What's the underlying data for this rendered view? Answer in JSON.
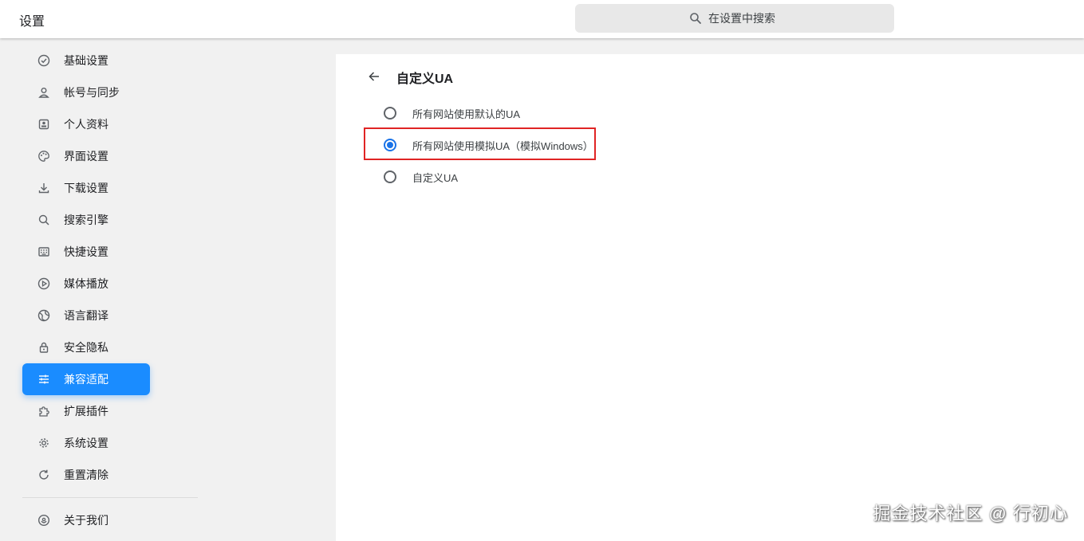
{
  "header": {
    "title": "设置",
    "search_placeholder": "在设置中搜索"
  },
  "sidebar": {
    "items": [
      {
        "label": "基础设置",
        "icon": "check-circle-icon",
        "active": false
      },
      {
        "label": "帐号与同步",
        "icon": "person-icon",
        "active": false
      },
      {
        "label": "个人资料",
        "icon": "profile-card-icon",
        "active": false
      },
      {
        "label": "界面设置",
        "icon": "palette-icon",
        "active": false
      },
      {
        "label": "下载设置",
        "icon": "download-icon",
        "active": false
      },
      {
        "label": "搜索引擎",
        "icon": "search-icon",
        "active": false
      },
      {
        "label": "快捷设置",
        "icon": "keyboard-icon",
        "active": false
      },
      {
        "label": "媒体播放",
        "icon": "play-circle-icon",
        "active": false
      },
      {
        "label": "语言翻译",
        "icon": "globe-icon",
        "active": false
      },
      {
        "label": "安全隐私",
        "icon": "lock-icon",
        "active": false
      },
      {
        "label": "兼容适配",
        "icon": "tune-icon",
        "active": true
      },
      {
        "label": "扩展插件",
        "icon": "puzzle-icon",
        "active": false
      },
      {
        "label": "系统设置",
        "icon": "gear-icon",
        "active": false
      },
      {
        "label": "重置清除",
        "icon": "refresh-icon",
        "active": false
      }
    ],
    "about": {
      "label": "关于我们",
      "icon": "about-logo-icon"
    }
  },
  "main": {
    "title": "自定义UA",
    "options": [
      {
        "label": "所有网站使用默认的UA",
        "checked": false
      },
      {
        "label": "所有网站使用模拟UA（模拟Windows）",
        "checked": true
      },
      {
        "label": "自定义UA",
        "checked": false
      }
    ]
  },
  "watermark": "掘金技术社区 @ 行初心",
  "colors": {
    "accent": "#1a8cff",
    "radio_checked": "#1a73e8",
    "highlight_border": "#e02424"
  }
}
